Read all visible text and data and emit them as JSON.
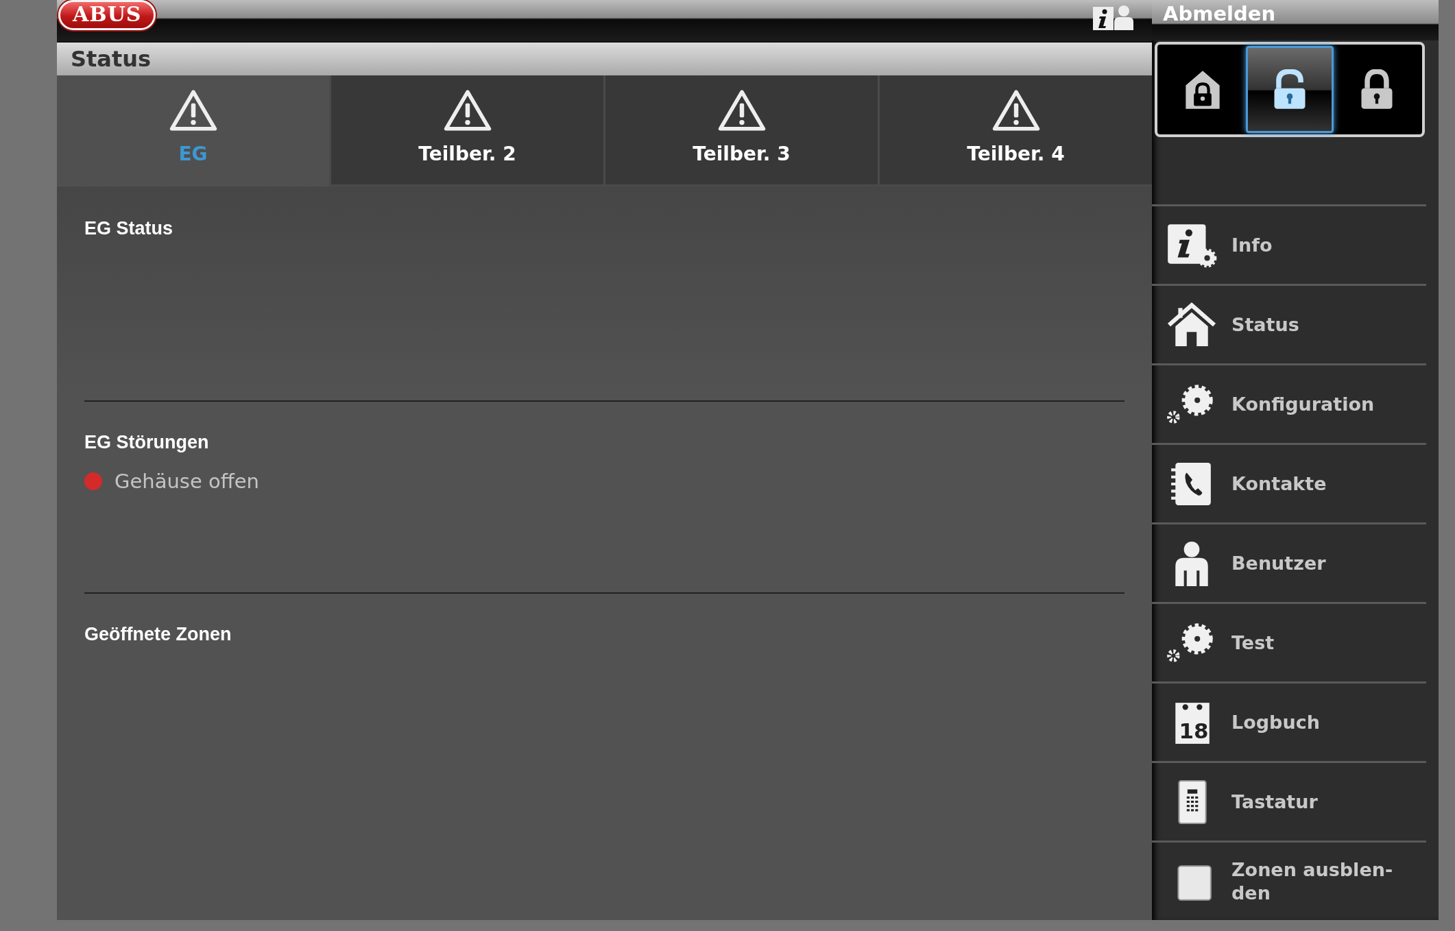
{
  "top_bar": {
    "logo": "ABUS"
  },
  "header": {
    "title": "Status"
  },
  "tabs": [
    {
      "label": "EG",
      "selected": true
    },
    {
      "label": "Teilber. 2",
      "selected": false
    },
    {
      "label": "Teilber. 3",
      "selected": false
    },
    {
      "label": "Teilber. 4",
      "selected": false
    }
  ],
  "sections": [
    {
      "title": "EG Status"
    },
    {
      "title": "EG Störungen",
      "items": [
        {
          "text": "Gehäuse offen",
          "color": "#d42a2a"
        }
      ]
    },
    {
      "title": "Geöffnete Zonen"
    }
  ],
  "sidebar": {
    "logout": "Abmelden",
    "arm_modes": [
      {
        "kind": "home",
        "selected": false
      },
      {
        "kind": "unlocked",
        "selected": true
      },
      {
        "kind": "locked",
        "selected": false
      }
    ],
    "items": [
      {
        "kind": "info",
        "label": "Info"
      },
      {
        "kind": "home",
        "label": "Status"
      },
      {
        "kind": "gears",
        "label": "Konfiguration"
      },
      {
        "kind": "contacts",
        "label": "Kontakte"
      },
      {
        "kind": "user",
        "label": "Benutzer"
      },
      {
        "kind": "gears",
        "label": "Test"
      },
      {
        "kind": "calendar",
        "icon_text": "18",
        "label": "Logbuch"
      },
      {
        "kind": "keypad",
        "label": "Tastatur"
      },
      {
        "kind": "checkbox",
        "label": "Zonen ausblen-den"
      }
    ]
  }
}
